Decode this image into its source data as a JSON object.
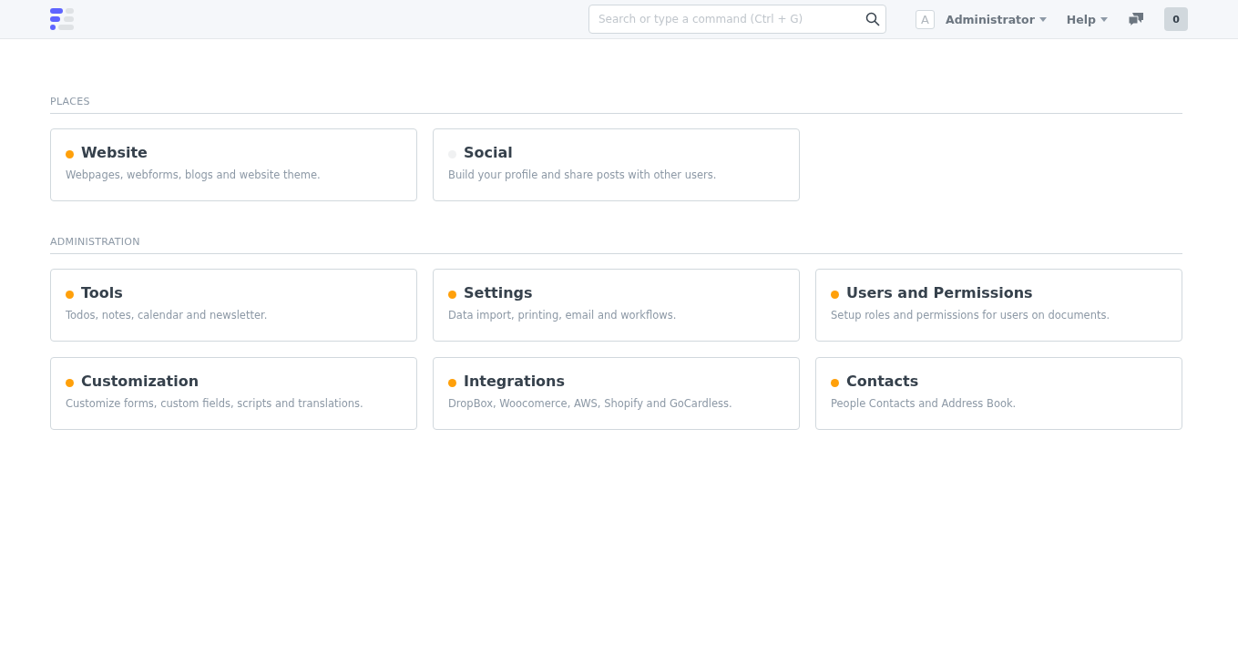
{
  "navbar": {
    "search": {
      "placeholder": "Search or type a command (Ctrl + G)"
    },
    "avatar": "A",
    "user_menu": "Administrator",
    "help_menu": "Help",
    "notification_count": "0"
  },
  "sections": [
    {
      "title": "PLACES",
      "modules": [
        {
          "name": "Website",
          "description": "Webpages, webforms, blogs and website theme.",
          "color": "#ffa00a"
        },
        {
          "name": "Social",
          "description": "Build your profile and share posts with other users.",
          "color": "#f0f1f2"
        }
      ]
    },
    {
      "title": "ADMINISTRATION",
      "modules": [
        {
          "name": "Tools",
          "description": "Todos, notes, calendar and newsletter.",
          "color": "#ffa00a"
        },
        {
          "name": "Settings",
          "description": "Data import, printing, email and workflows.",
          "color": "#ffa00a"
        },
        {
          "name": "Users and Permissions",
          "description": "Setup roles and permissions for users on documents.",
          "color": "#ffa00a"
        },
        {
          "name": "Customization",
          "description": "Customize forms, custom fields, scripts and translations.",
          "color": "#ffa00a"
        },
        {
          "name": "Integrations",
          "description": "DropBox, Woocomerce, AWS, Shopify and GoCardless.",
          "color": "#ffa00a"
        },
        {
          "name": "Contacts",
          "description": "People Contacts and Address Book.",
          "color": "#ffa00a"
        }
      ]
    }
  ]
}
